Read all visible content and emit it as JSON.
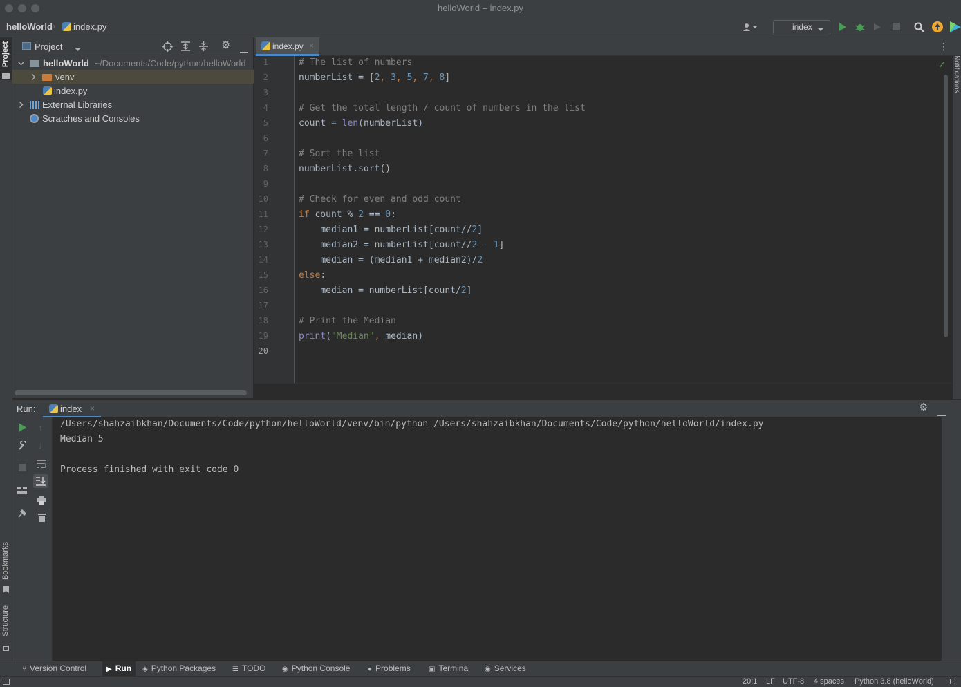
{
  "window": {
    "title": "helloWorld – index.py"
  },
  "navbar": {
    "project": "helloWorld",
    "file": "index.py",
    "run_config": "index"
  },
  "left_strip": {
    "project": "Project",
    "bookmarks": "Bookmarks",
    "structure": "Structure"
  },
  "right_strip": {
    "notifications": "Notifications"
  },
  "project_panel": {
    "title": "Project",
    "tree": [
      {
        "label": "helloWorld",
        "path": "~/Documents/Code/python/helloWorld"
      },
      {
        "label": "venv"
      },
      {
        "label": "index.py"
      },
      {
        "label": "External Libraries"
      },
      {
        "label": "Scratches and Consoles"
      }
    ]
  },
  "editor": {
    "tab": "index.py",
    "line_numbers": [
      "1",
      "2",
      "3",
      "4",
      "5",
      "6",
      "7",
      "8",
      "9",
      "10",
      "11",
      "12",
      "13",
      "14",
      "15",
      "16",
      "17",
      "18",
      "19",
      "20"
    ],
    "code": [
      "# The list of numbers",
      "numberList = [2, 3, 5, 7, 8]",
      "",
      "# Get the total length / count of numbers in the list",
      "count = len(numberList)",
      "",
      "# Sort the list",
      "numberList.sort()",
      "",
      "# Check for even and odd count",
      "if count % 2 == 0:",
      "    median1 = numberList[count//2]",
      "    median2 = numberList[count//2 - 1]",
      "    median = (median1 + median2)/2",
      "else:",
      "    median = numberList[count/2]",
      "",
      "# Print the Median",
      "print(\"Median\", median)",
      ""
    ]
  },
  "run_panel": {
    "label": "Run:",
    "tab": "index",
    "output": [
      "/Users/shahzaibkhan/Documents/Code/python/helloWorld/venv/bin/python /Users/shahzaibkhan/Documents/Code/python/helloWorld/index.py",
      "Median 5",
      "",
      "Process finished with exit code 0"
    ]
  },
  "bottom_tabs": [
    "Version Control",
    "Run",
    "Python Packages",
    "TODO",
    "Python Console",
    "Problems",
    "Terminal",
    "Services"
  ],
  "status_bar": {
    "position": "20:1",
    "line_sep": "LF",
    "encoding": "UTF-8",
    "indent": "4 spaces",
    "interpreter": "Python 3.8 (helloWorld)"
  },
  "colors": {
    "accent": "#4a88c7",
    "run_green": "#499c54",
    "update_orange": "#f0a732"
  }
}
